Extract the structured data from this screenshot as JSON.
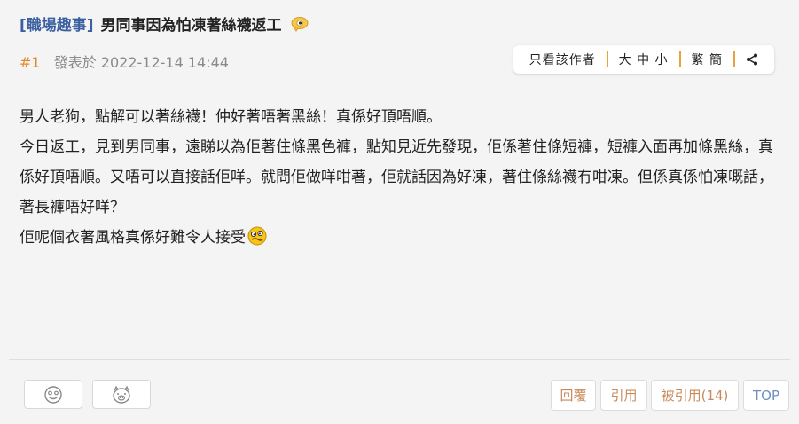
{
  "header": {
    "category": "[職場趣事]",
    "title": "男同事因為怕凍著絲襪返工"
  },
  "meta": {
    "floor": "#1",
    "posted": "發表於 2022-12-14 14:44"
  },
  "toolbar": {
    "author_only": "只看該作者",
    "font_size": "大 中 小",
    "traditional": "繁 簡"
  },
  "content": {
    "p1": "男人老狗，點解可以著絲襪！仲好著唔著黑絲！真係好頂唔順。",
    "p2": "今日返工，見到男同事，遠睇以為佢著住條黑色褲，點知見近先發現，佢係著住條短褲，短褲入面再加條黑絲，真係好頂唔順。又唔可以直接話佢咩。就問佢做咩咁著，佢就話因為好凍，著住條絲襪冇咁凍。但係真係怕凍嘅話，著長褲唔好咩？",
    "p3": "佢呢個衣著風格真係好難令人接受"
  },
  "actions": {
    "reply": "回覆",
    "quote": "引用",
    "quoted": "被引用(14)",
    "top": "TOP"
  }
}
